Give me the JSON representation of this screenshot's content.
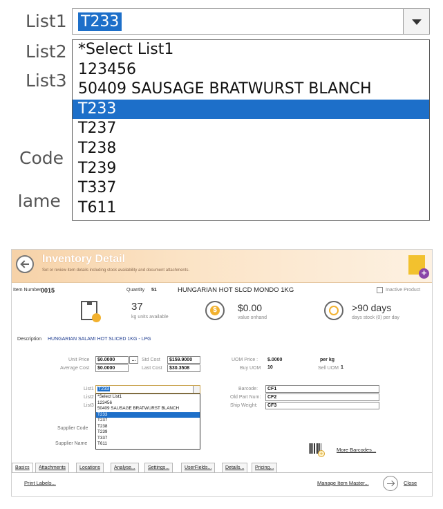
{
  "zoom": {
    "labels": [
      "List1",
      "List2",
      "List3",
      "Code",
      "Name"
    ],
    "combo_value": "T233",
    "list_items": [
      "*Select List1",
      "123456",
      "50409 SAUSAGE BRATWURST BLANCH",
      "T233",
      "T237",
      "T238",
      "T239",
      "T337",
      "T611"
    ],
    "selected_item": "T233"
  },
  "header": {
    "title": "Inventory Detail",
    "subtitle": "Set or review item details including stock availability and document attachments."
  },
  "item": {
    "number_label": "Item Number",
    "number": "0015",
    "quantity_label": "Quantity",
    "quantity": "51",
    "name": "HUNGARIAN HOT SLCD MONDO 1KG",
    "inactive_label": "Inactive Product"
  },
  "stats": {
    "units_value": "37",
    "units_label": "kg units available",
    "value_value": "$0.00",
    "value_label": "value onhand",
    "days_value": ">90 days",
    "days_label": "days stock (0) per day"
  },
  "description": {
    "label": "Description",
    "value": "HUNGARIAN SALAMI HOT SLICED 1KG - LPG"
  },
  "pricing": {
    "unit_price_label": "Unit Price",
    "unit_price": "$0.0000",
    "ellipsis": "...",
    "std_cost_label": "Std Cost",
    "std_cost": "$159.9000",
    "average_cost_label": "Average Cost",
    "average_cost": "$0.0000",
    "last_cost_label": "Last Cost",
    "last_cost": "$30.3508",
    "uom_price_label": "UOM Price :",
    "uom_price": "$.0000",
    "per_label": "per kg",
    "buy_uom_label": "Buy UOM",
    "buy_uom": "10",
    "sell_uom_label": "Sell UOM",
    "sell_uom": "1"
  },
  "lists": {
    "list1_label": "List1",
    "list2_label": "List2",
    "list3_label": "List3",
    "list1_value": "T233",
    "items": [
      "*Select List1",
      "123456",
      "50409 SAUSAGE BRATWURST BLANCH",
      "T233",
      "T237",
      "T238",
      "T239",
      "T337",
      "T611"
    ],
    "selected_item": "T233"
  },
  "custom_fields": {
    "barcode_label": "Barcode:",
    "barcode": "CF1",
    "old_part_label": "Old Part Num:",
    "old_part": "CF2",
    "ship_weight_label": "Ship Weight:",
    "ship_weight": "CF3"
  },
  "supplier": {
    "code_label": "Supplier Code",
    "name_label": "Supplier Name"
  },
  "barcodes": {
    "more_label": "More Barcodes..."
  },
  "tabs": [
    "Basics",
    "Attachments",
    "Locations",
    "Analyse...",
    "Settings...",
    "UserFields...",
    "Details...",
    "Pricing..."
  ],
  "footer": {
    "print_labels": "Print Labels...",
    "manage_item_master": "Manage Item Master...",
    "close": "Close"
  },
  "colors": {
    "header_orange": "#f6d2a8",
    "selection_blue": "#1d6fc9",
    "accent_purple": "#8b45a8",
    "accent_yellow": "#f2c12e"
  }
}
